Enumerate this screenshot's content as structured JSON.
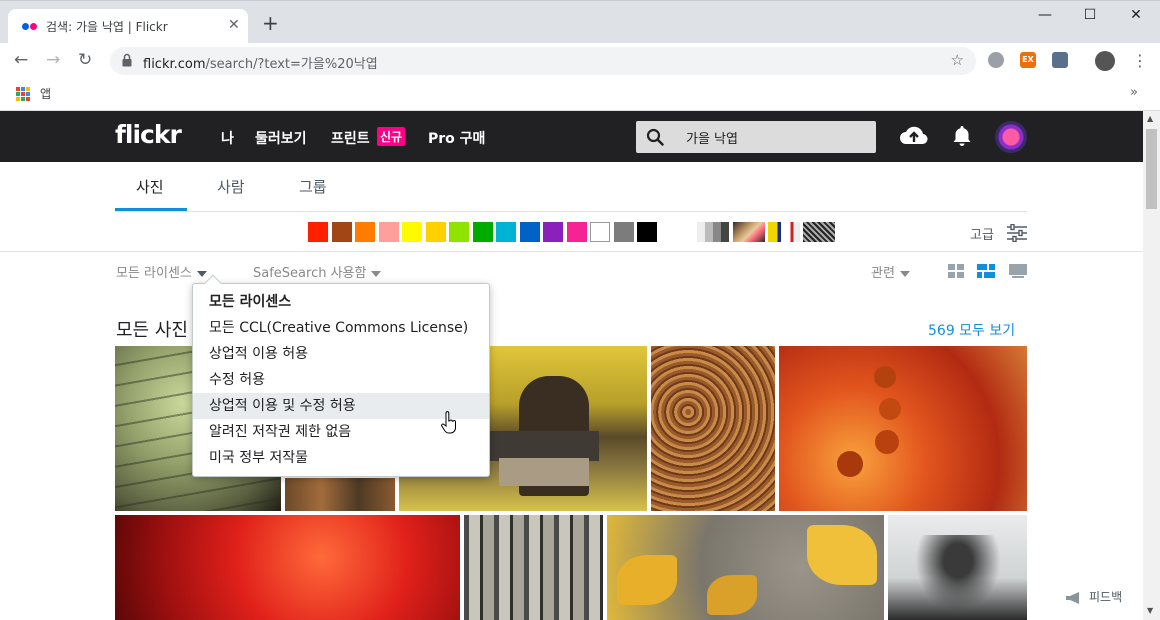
{
  "browser": {
    "tab_title": "검색: 가을 낙엽 | Flickr",
    "tab_close": "✕",
    "new_tab": "+",
    "window_controls": {
      "minimize": "—",
      "maximize": "☐",
      "close": "✕"
    },
    "nav": {
      "back": "←",
      "forward": "→",
      "reload": "↻"
    },
    "url_host": "flickr.com",
    "url_rest": "/search/?text=가을%20낙엽",
    "bookmark_star": "☆",
    "extensions": [
      "cloud-extension-icon",
      "ex-extension-icon",
      "puzzle-extension-icon"
    ],
    "ext_ex_label": "EX",
    "menu": "⋮",
    "bookmarks_apps_label": "앱",
    "bookmarks_more": "»"
  },
  "flickr": {
    "logo": "flickr",
    "nav": [
      {
        "label": "나"
      },
      {
        "label": "둘러보기"
      },
      {
        "label": "프린트"
      },
      {
        "label": "Pro 구매"
      }
    ],
    "new_badge": "신규",
    "search_value": "가을 낙엽",
    "tabs": [
      {
        "label": "사진",
        "active": true
      },
      {
        "label": "사람",
        "active": false
      },
      {
        "label": "그룹",
        "active": false
      }
    ],
    "colors": [
      "#ff2000",
      "#a24615",
      "#ff7c00",
      "#ff9f9c",
      "#fffa00",
      "#ffcf00",
      "#90e200",
      "#00ab00",
      "#00b2d4",
      "#0062c6",
      "#8c20ba",
      "#f52394",
      "#ffffff",
      "#7c7c7c",
      "#000000"
    ],
    "styles": [
      "black-and-white",
      "shallow-depth-of-field",
      "minimalist",
      "patterns"
    ],
    "advanced_label": "고급",
    "filters": {
      "license": "모든 라이센스",
      "safesearch": "SafeSearch 사용함",
      "sort": "관련"
    },
    "results_title": "모든 사진",
    "results_count": "569 모두 보기",
    "license_menu": {
      "items": [
        {
          "label": "모든 라이센스",
          "selected": true
        },
        {
          "label": "모든 CCL(Creative Commons License)"
        },
        {
          "label": "상업적 이용 허용"
        },
        {
          "label": "수정 허용"
        },
        {
          "label": "상업적 이용 및 수정 허용",
          "hover": true
        },
        {
          "label": "알려진 저작권 제한 없음"
        },
        {
          "label": "미국 정부 저작물"
        }
      ]
    },
    "feedback_label": "피드백"
  }
}
